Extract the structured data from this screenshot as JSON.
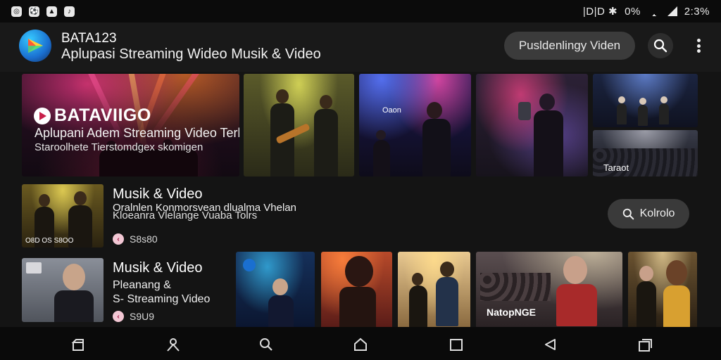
{
  "status_bar": {
    "left_icons": [
      "instagram-icon",
      "soccer-icon",
      "image-icon",
      "tiktok-icon"
    ],
    "right_text": "|D|D ✱",
    "battery_text": "0%",
    "time_text": "2:3%"
  },
  "header": {
    "app_name": "BATA123",
    "app_subtitle": "Aplupasi Streaming Wideo  Musik & Video",
    "search_pill_text": "Pusldenlingy Viden"
  },
  "hero": {
    "brand": "BATAVIIGO",
    "tagline": "Aplupani Adem Streaming Video Terbal oadn",
    "tagline2": "Staroolhete Tierstomdgex skomigen",
    "tile_c_label": "Oaon",
    "tile_e_label": "Taraot"
  },
  "row1": {
    "title": "Musik & Video",
    "desc_line1": "Oralnlen  Konmorsvean dlualma Vhelan",
    "desc_line2": "Kloeanra Vlelange Vuaba Tolrs",
    "meta_value": "S8s80",
    "thumb_caption": "O8D OS S8OO",
    "action_label": "Kolrolo"
  },
  "row2": {
    "title": "Musik & Video",
    "desc_line1": "Pleanang &",
    "desc_line2": "S- Streaming Video",
    "meta_value": "S9U9"
  },
  "cards": {
    "card_d_label": "NatopNGE"
  },
  "colors": {
    "background": "#141414",
    "header_bg": "#191919",
    "pill_bg": "#3b3b3b",
    "accent_pink": "#f2c7d4"
  }
}
